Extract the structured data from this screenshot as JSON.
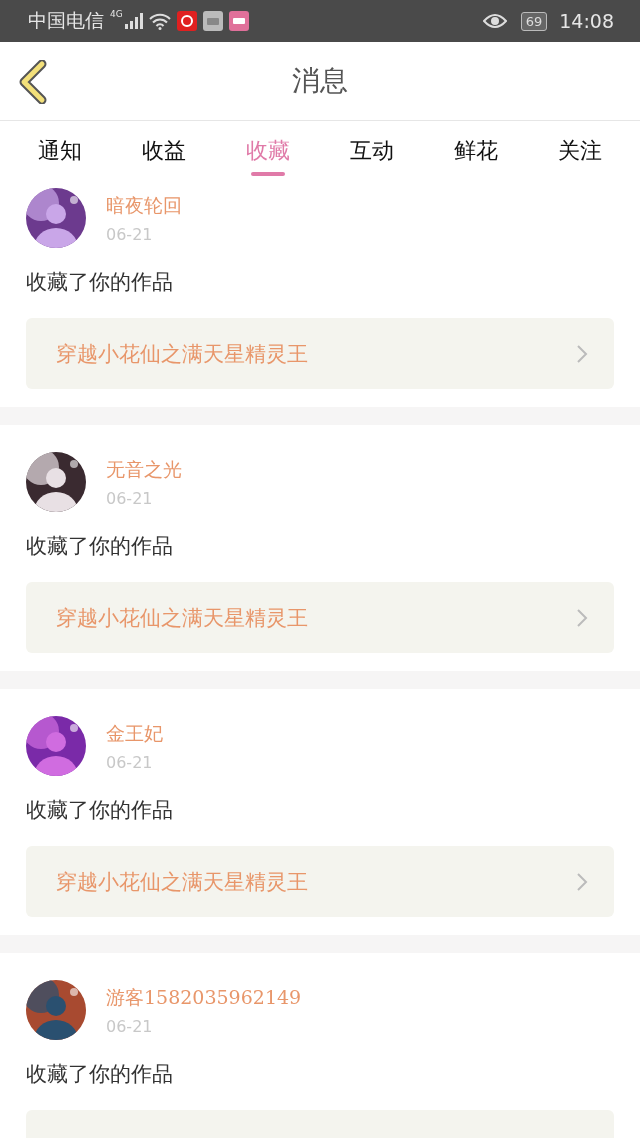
{
  "status_bar": {
    "carrier": "中国电信",
    "network": "4G",
    "battery": "69",
    "time": "14:08"
  },
  "header": {
    "title": "消息"
  },
  "tabs": [
    {
      "label": "通知",
      "selected": false
    },
    {
      "label": "收益",
      "selected": false
    },
    {
      "label": "收藏",
      "selected": true
    },
    {
      "label": "互动",
      "selected": false
    },
    {
      "label": "鲜花",
      "selected": false
    },
    {
      "label": "关注",
      "selected": false
    }
  ],
  "messages": [
    {
      "name": "暗夜轮回",
      "date": "06-21",
      "text": "收藏了你的作品",
      "work": "穿越小花仙之满天星精灵王"
    },
    {
      "name": "无音之光",
      "date": "06-21",
      "text": "收藏了你的作品",
      "work": "穿越小花仙之满天星精灵王"
    },
    {
      "name": "金王妃",
      "date": "06-21",
      "text": "收藏了你的作品",
      "work": "穿越小花仙之满天星精灵王"
    },
    {
      "name": "游客1582035962149",
      "date": "06-21",
      "text": "收藏了你的作品"
    }
  ]
}
